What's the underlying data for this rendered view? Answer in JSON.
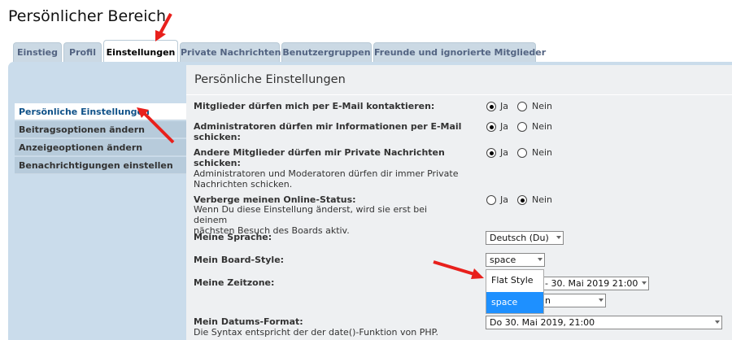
{
  "page": {
    "title": "Persönlicher Bereich"
  },
  "tabs": [
    {
      "label": "Einstieg"
    },
    {
      "label": "Profil"
    },
    {
      "label": "Einstellungen"
    },
    {
      "label": "Private Nachrichten"
    },
    {
      "label": "Benutzergruppen"
    },
    {
      "label": "Freunde und ignorierte Mitglieder"
    }
  ],
  "active_tab": "Einstellungen",
  "sidebar": {
    "items": [
      {
        "label": "Persönliche Einstellungen"
      },
      {
        "label": "Beitragsoptionen ändern"
      },
      {
        "label": "Anzeigeoptionen ändern"
      },
      {
        "label": "Benachrichtigungen einstellen"
      }
    ]
  },
  "main": {
    "title": "Persönliche Einstellungen",
    "options": [
      {
        "label": "Mitglieder dürfen mich per E-Mail kontaktieren:",
        "yes": "Ja",
        "no": "Nein",
        "value": "Ja"
      },
      {
        "label_line1": "Administratoren dürfen mir Informationen per E-Mail",
        "label_line2": "schicken:",
        "yes": "Ja",
        "no": "Nein",
        "value": "Ja"
      },
      {
        "label_line1": "Andere Mitglieder dürfen mir Private Nachrichten",
        "label_line2": "schicken:",
        "explain_line1": "Administratoren und Moderatoren dürfen dir immer Private",
        "explain_line2": "Nachrichten schicken.",
        "yes": "Ja",
        "no": "Nein",
        "value": "Ja"
      },
      {
        "label": "Verberge meinen Online-Status:",
        "explain_line1": "Wenn Du diese Einstellung änderst, wird sie erst bei deinem",
        "explain_line2": "nächsten Besuch des Boards aktiv.",
        "yes": "Ja",
        "no": "Nein",
        "value": "Nein"
      }
    ],
    "language": {
      "label": "Meine Sprache:",
      "value": "Deutsch (Du)"
    },
    "style": {
      "label": "Mein Board-Style:",
      "value": "space",
      "options": [
        "Flat Style",
        "space"
      ]
    },
    "timezone": {
      "label": "Meine Zeitzone:",
      "date_value": "- 30. Mai 2019 21:00",
      "zone_value": "n"
    },
    "date_format": {
      "label": "Mein Datums-Format:",
      "explain": "Die Syntax entspricht der der date()-Funktion von PHP.",
      "value": "Do 30. Mai 2019, 21:00"
    }
  },
  "colors": {
    "annotation_arrow": "#e8201c",
    "panel": "#cadceb",
    "highlight": "#1e90ff"
  }
}
